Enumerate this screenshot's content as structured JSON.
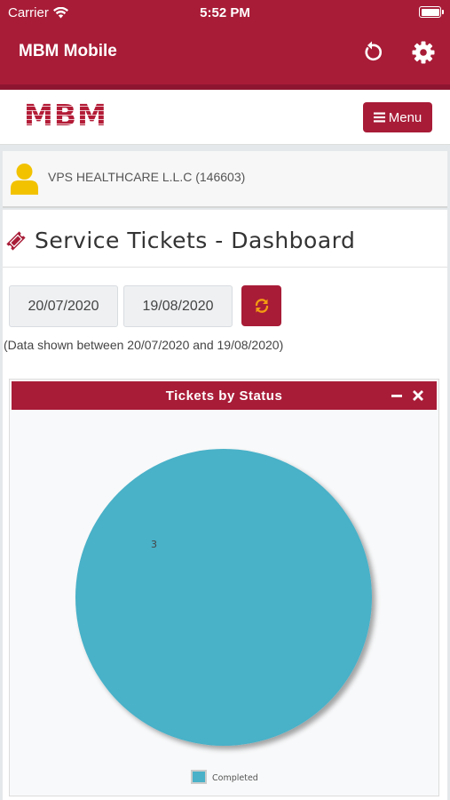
{
  "status_bar": {
    "carrier": "Carrier",
    "time": "5:52 PM"
  },
  "header": {
    "title": "MBM Mobile",
    "refresh_icon": "refresh-icon",
    "settings_icon": "gear-icon",
    "color": "#a81c37"
  },
  "navbar": {
    "logo": "MBM",
    "menu_label": "Menu",
    "menu_icon": "hamburger-icon"
  },
  "account": {
    "name": "VPS HEALTHCARE L.L.C (146603)",
    "icon": "user-icon",
    "icon_color": "#f2c200"
  },
  "dashboard": {
    "title": "Service Tickets - Dashboard",
    "title_icon": "ticket-icon",
    "date_from": "20/07/2020",
    "date_to": "19/08/2020",
    "range_text": "(Data shown between 20/07/2020 and 19/08/2020)"
  },
  "widget": {
    "title": "Tickets by Status",
    "minimize_icon": "minus-icon",
    "close_icon": "close-icon"
  },
  "chart_data": {
    "type": "pie",
    "categories": [
      "Completed"
    ],
    "values": [
      3
    ],
    "data_labels": [
      "3"
    ],
    "colors": [
      "#4ab1c8"
    ],
    "legend": "bottom",
    "title": ""
  }
}
